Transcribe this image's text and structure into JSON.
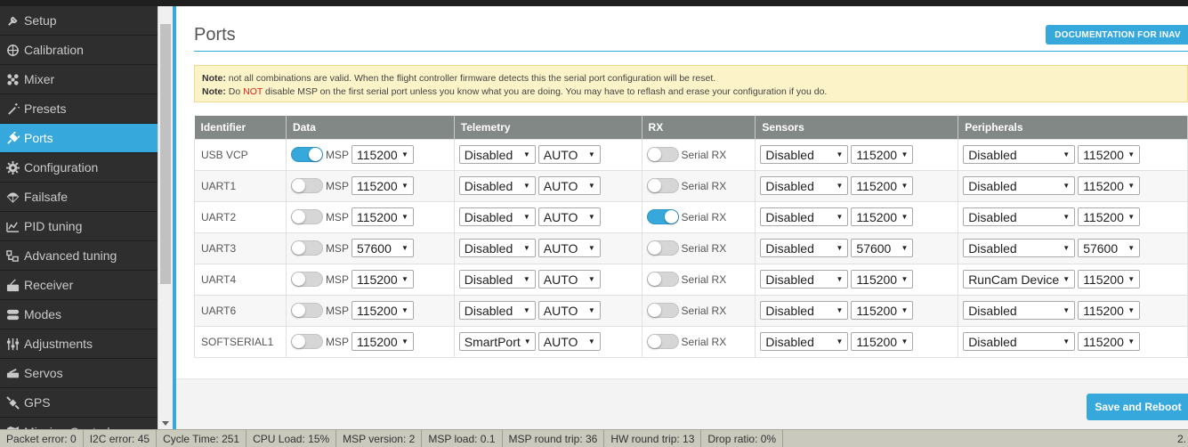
{
  "sidebar": {
    "items": [
      {
        "label": "Setup",
        "icon": "wrench-icon"
      },
      {
        "label": "Calibration",
        "icon": "crosshair-icon"
      },
      {
        "label": "Mixer",
        "icon": "mixer-icon"
      },
      {
        "label": "Presets",
        "icon": "wand-icon"
      },
      {
        "label": "Ports",
        "icon": "plug-icon"
      },
      {
        "label": "Configuration",
        "icon": "gear-icon"
      },
      {
        "label": "Failsafe",
        "icon": "parachute-icon"
      },
      {
        "label": "PID tuning",
        "icon": "pid-icon"
      },
      {
        "label": "Advanced tuning",
        "icon": "tuning-icon"
      },
      {
        "label": "Receiver",
        "icon": "receiver-icon"
      },
      {
        "label": "Modes",
        "icon": "modes-icon"
      },
      {
        "label": "Adjustments",
        "icon": "sliders-icon"
      },
      {
        "label": "Servos",
        "icon": "servo-icon"
      },
      {
        "label": "GPS",
        "icon": "satellite-icon"
      },
      {
        "label": "Mission Control",
        "icon": "map-icon"
      }
    ],
    "active": "Ports"
  },
  "page": {
    "title": "Ports",
    "doc_button": "DOCUMENTATION FOR INAV",
    "note1_label": "Note:",
    "note1_text": " not all combinations are valid. When the flight controller firmware detects this the serial port configuration will be reset.",
    "note2_label": "Note:",
    "note2_pre": " Do ",
    "note2_not": "NOT",
    "note2_post": " disable MSP on the first serial port unless you know what you are doing. You may have to reflash and erase your configuration if you do.",
    "save_button": "Save and Reboot"
  },
  "table": {
    "headers": [
      "Identifier",
      "Data",
      "Telemetry",
      "RX",
      "Sensors",
      "Peripherals"
    ],
    "msp_label": "MSP",
    "rx_label": "Serial RX",
    "rows": [
      {
        "id": "USB VCP",
        "msp_on": true,
        "msp_baud": "115200",
        "telemetry": "Disabled",
        "telemetry_baud": "AUTO",
        "rx_on": false,
        "sensors": "Disabled",
        "sensors_baud": "115200",
        "peripherals": "Disabled",
        "peripherals_baud": "115200"
      },
      {
        "id": "UART1",
        "msp_on": false,
        "msp_baud": "115200",
        "telemetry": "Disabled",
        "telemetry_baud": "AUTO",
        "rx_on": false,
        "sensors": "Disabled",
        "sensors_baud": "115200",
        "peripherals": "Disabled",
        "peripherals_baud": "115200"
      },
      {
        "id": "UART2",
        "msp_on": false,
        "msp_baud": "115200",
        "telemetry": "Disabled",
        "telemetry_baud": "AUTO",
        "rx_on": true,
        "sensors": "Disabled",
        "sensors_baud": "115200",
        "peripherals": "Disabled",
        "peripherals_baud": "115200"
      },
      {
        "id": "UART3",
        "msp_on": false,
        "msp_baud": "57600",
        "telemetry": "Disabled",
        "telemetry_baud": "AUTO",
        "rx_on": false,
        "sensors": "Disabled",
        "sensors_baud": "57600",
        "peripherals": "Disabled",
        "peripherals_baud": "57600"
      },
      {
        "id": "UART4",
        "msp_on": false,
        "msp_baud": "115200",
        "telemetry": "Disabled",
        "telemetry_baud": "AUTO",
        "rx_on": false,
        "sensors": "Disabled",
        "sensors_baud": "115200",
        "peripherals": "RunCam Device",
        "peripherals_baud": "115200"
      },
      {
        "id": "UART6",
        "msp_on": false,
        "msp_baud": "115200",
        "telemetry": "Disabled",
        "telemetry_baud": "AUTO",
        "rx_on": false,
        "sensors": "Disabled",
        "sensors_baud": "115200",
        "peripherals": "Disabled",
        "peripherals_baud": "115200"
      },
      {
        "id": "SOFTSERIAL1",
        "msp_on": false,
        "msp_baud": "115200",
        "telemetry": "SmartPort",
        "telemetry_baud": "AUTO",
        "rx_on": false,
        "sensors": "Disabled",
        "sensors_baud": "115200",
        "peripherals": "Disabled",
        "peripherals_baud": "115200"
      }
    ]
  },
  "status": {
    "packet_error": "Packet error: 0",
    "i2c_error": "I2C error: 45",
    "cycle_time": "Cycle Time: 251",
    "cpu_load": "CPU Load: 15%",
    "msp_version": "MSP version: 2",
    "msp_load": "MSP load: 0.1",
    "msp_round_trip": "MSP round trip: 36",
    "hw_round_trip": "HW round trip: 13",
    "drop_ratio": "Drop ratio: 0%",
    "version_fragment": "2."
  },
  "colors": {
    "accent": "#37a8db",
    "sidebar_bg": "#2e2e2e",
    "table_header": "#828885",
    "note_bg": "#fdf3c9",
    "note_red": "#e2231a"
  }
}
